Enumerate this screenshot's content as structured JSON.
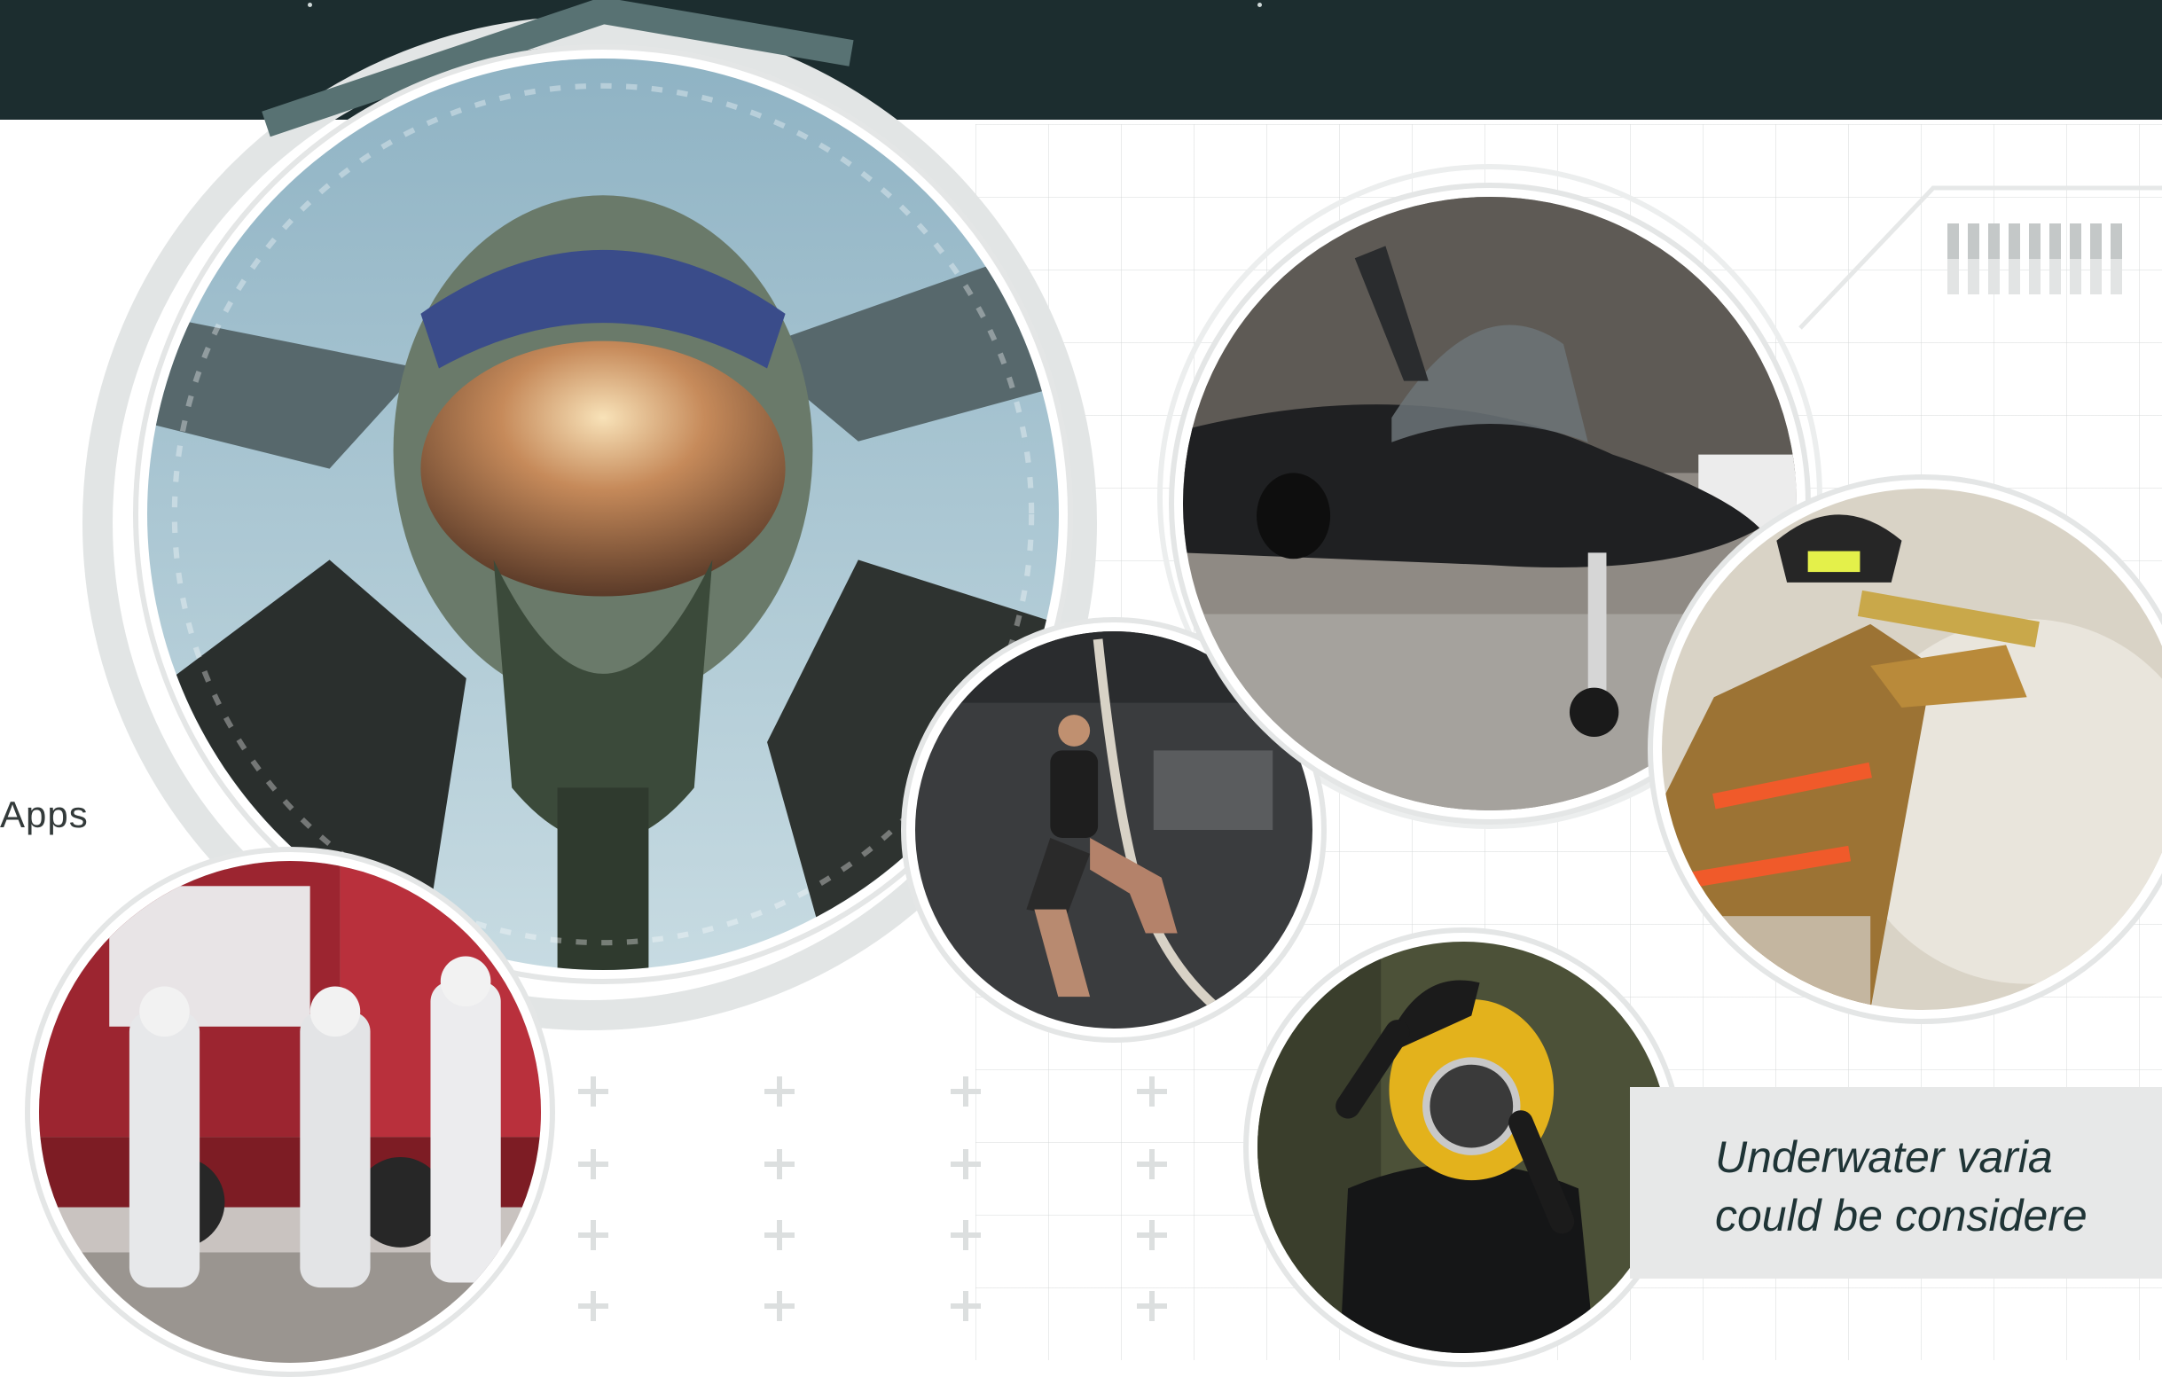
{
  "left_label": "Apps",
  "caption": {
    "line1": "Underwater varia",
    "line2": "could be considere"
  },
  "photos": [
    {
      "subject": "pilot in oxygen mask and helmet inside a jet cockpit with aircraft overhead"
    },
    {
      "subject": "firefighters in silver proximity suits beside a red fire truck"
    },
    {
      "subject": "athlete climbing a rope in a gym"
    },
    {
      "subject": "black jet trainer aircraft on the flight line with canopy open"
    },
    {
      "subject": "firefighter spraying a hose through smoke"
    },
    {
      "subject": "diver fitting a yellow dive helmet"
    }
  ],
  "colors": {
    "header": "#1c2d2f",
    "caption_text": "#1f3436",
    "caption_bg": "#e7e8e8",
    "ring": "#e4e6e6"
  }
}
